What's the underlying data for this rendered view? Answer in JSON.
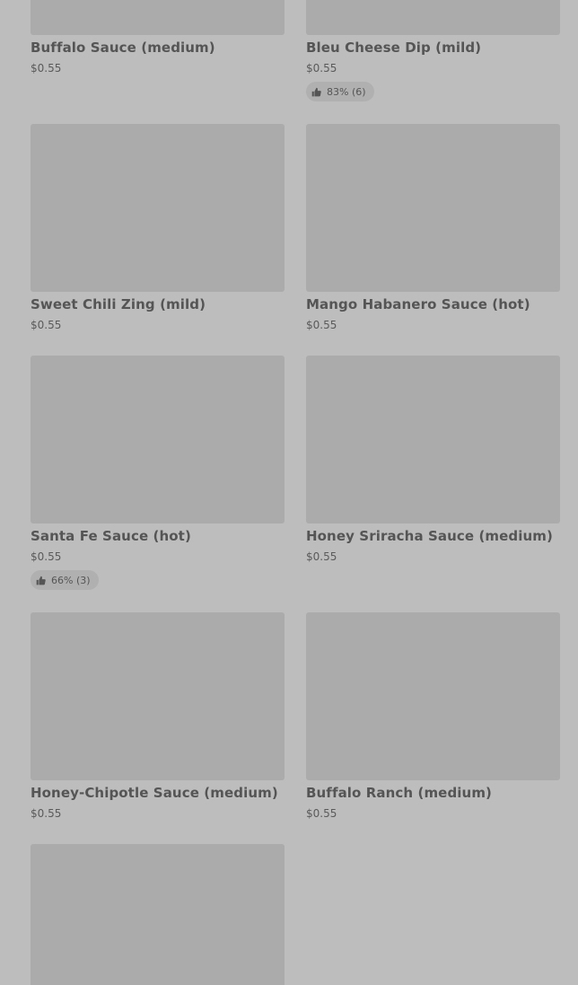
{
  "items": [
    {
      "name": "Buffalo Sauce (medium)",
      "price": "$0.55"
    },
    {
      "name": "Bleu Cheese Dip (mild)",
      "price": "$0.55",
      "rating": "83% (6)"
    },
    {
      "name": "Sweet Chili Zing (mild)",
      "price": "$0.55"
    },
    {
      "name": "Mango Habanero Sauce (hot)",
      "price": "$0.55"
    },
    {
      "name": "Santa Fe Sauce (hot)",
      "price": "$0.55",
      "rating": "66% (3)"
    },
    {
      "name": "Honey Sriracha Sauce (medium)",
      "price": "$0.55"
    },
    {
      "name": "Honey-Chipotle Sauce (medium)",
      "price": "$0.55"
    },
    {
      "name": "Buffalo Ranch (medium)",
      "price": "$0.55"
    },
    {
      "name": "",
      "price": ""
    }
  ],
  "icons": {
    "rating": "thumbs-up-icon"
  },
  "colors": {
    "background": "#bdbdbd",
    "image_placeholder": "#ababab",
    "text": "#555555"
  }
}
